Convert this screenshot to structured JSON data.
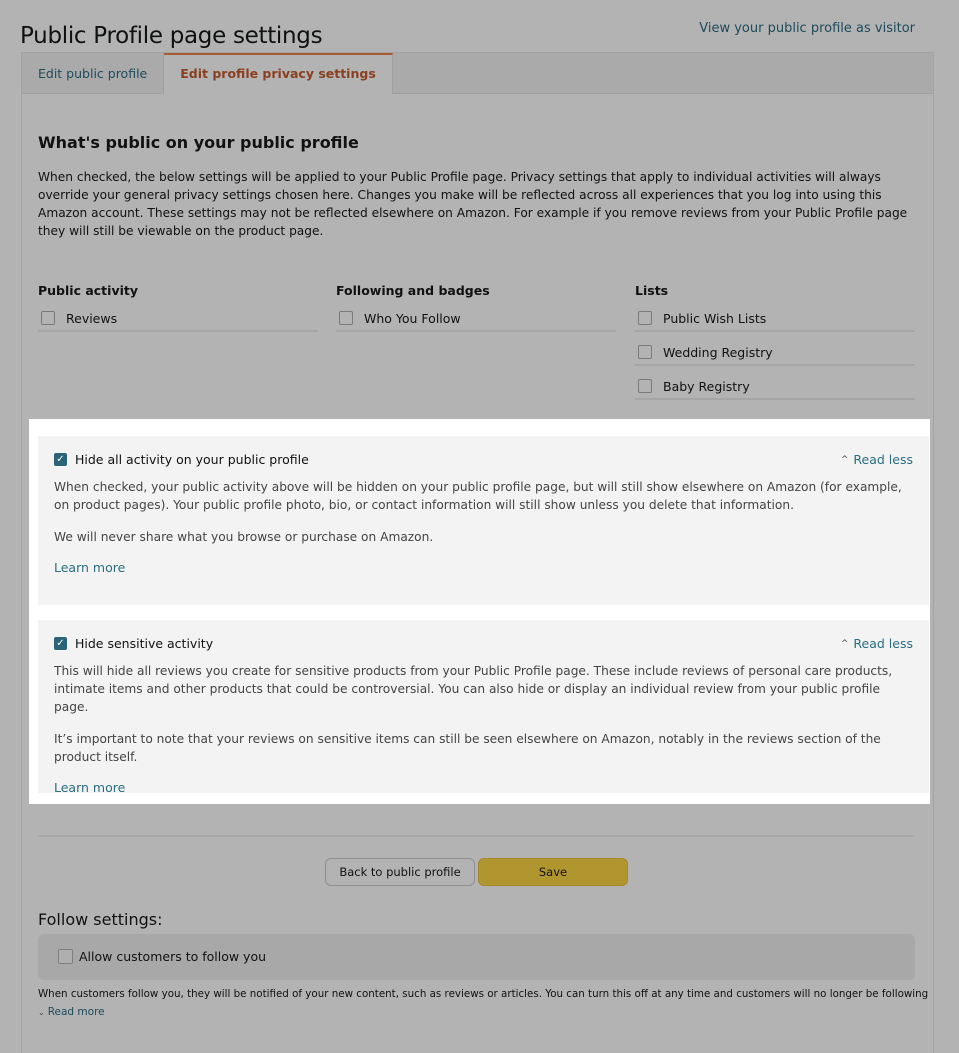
{
  "header": {
    "title": "Public Profile page settings",
    "visitor_link": "View your public profile as visitor"
  },
  "tabs": [
    {
      "label": "Edit public profile",
      "active": false
    },
    {
      "label": "Edit profile privacy settings",
      "active": true
    }
  ],
  "privacy": {
    "heading": "What's public on your public profile",
    "description": "When checked, the below settings will be applied to your Public Profile page. Privacy settings that apply to individual activities will always override your general privacy settings chosen here. Changes you make will be reflected across all experiences that you log into using this Amazon account. These settings may not be reflected elsewhere on Amazon. For example if you remove reviews from your Public Profile page they will still be viewable on the product page.",
    "columns": [
      {
        "heading": "Public activity",
        "options": [
          {
            "label": "Reviews",
            "checked": false
          }
        ]
      },
      {
        "heading": "Following and badges",
        "options": [
          {
            "label": "Who You Follow",
            "checked": false
          }
        ]
      },
      {
        "heading": "Lists",
        "options": [
          {
            "label": "Public Wish Lists",
            "checked": false
          },
          {
            "label": "Wedding Registry",
            "checked": false
          },
          {
            "label": "Baby Registry",
            "checked": false
          }
        ]
      }
    ]
  },
  "cards": [
    {
      "title": "Hide all activity on your public profile",
      "checked": true,
      "toggle_label": "Read less",
      "paragraphs": [
        "When checked, your public activity above will be hidden on your public profile page, but will still show elsewhere on Amazon (for example, on product pages). Your public profile photo, bio, or contact information will still show unless you delete that information.",
        "We will never share what you browse or purchase on Amazon."
      ],
      "learn_more": "Learn more"
    },
    {
      "title": "Hide sensitive activity",
      "checked": true,
      "toggle_label": "Read less",
      "paragraphs": [
        "This will hide all reviews you create for sensitive products from your Public Profile page. These include reviews of personal care products, intimate items and other products that could be controversial. You can also hide or display an individual review from your public profile page.",
        "It’s important to note that your reviews on sensitive items can still be seen elsewhere on Amazon, notably in the reviews section of the product itself."
      ],
      "learn_more": "Learn more"
    }
  ],
  "actions": {
    "back_label": "Back to public profile",
    "save_label": "Save"
  },
  "follow": {
    "heading": "Follow settings:",
    "option_label": "Allow customers to follow you",
    "option_checked": false,
    "description": "When customers follow you, they will be notified of your new content, such as reviews or articles. You can turn this off at any time and customers will no longer be following you. We",
    "read_more": "Read more"
  },
  "colors": {
    "link": "#2b6e80",
    "active_tab": "#8a3f1f",
    "checkbox_checked": "#2b6477",
    "save_button": "#b1962f",
    "overlay_bg": "#b3b3b3"
  }
}
